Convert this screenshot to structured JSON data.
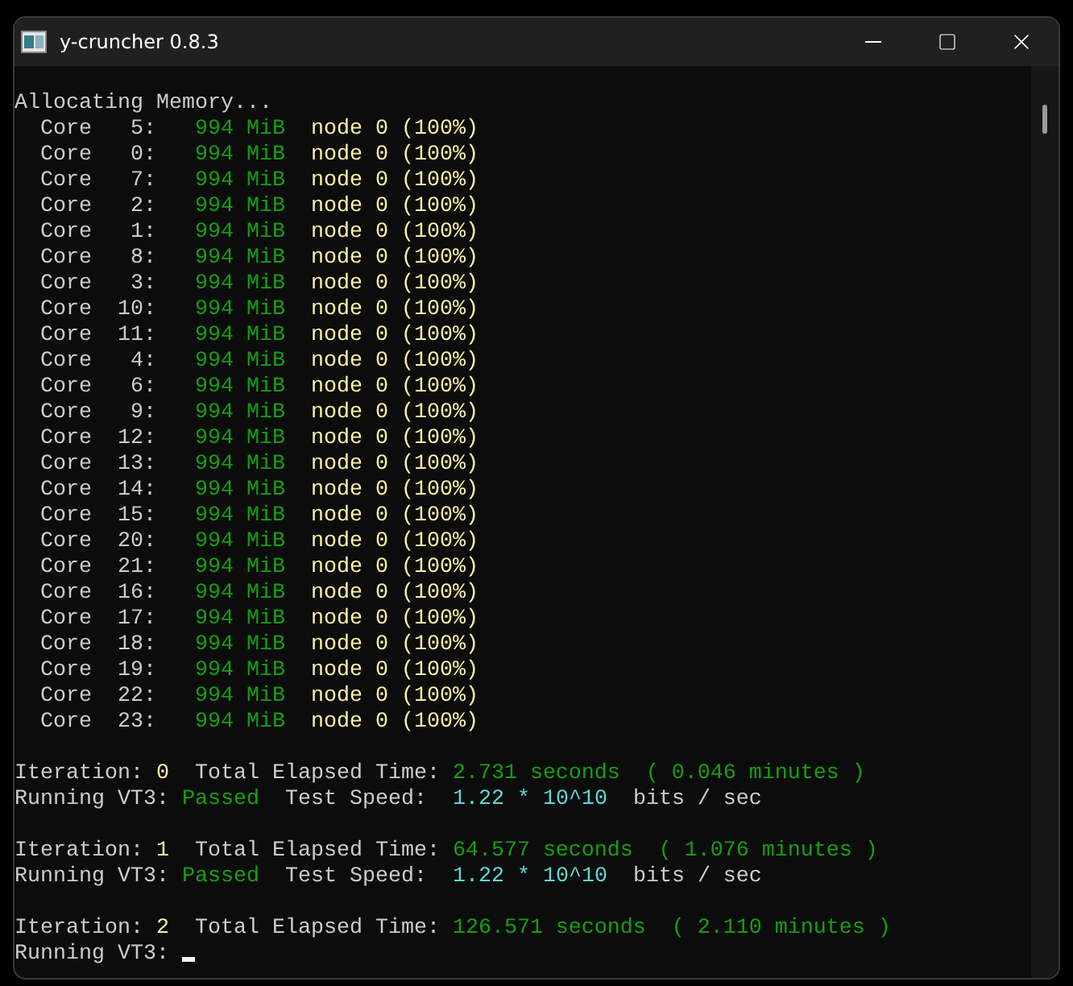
{
  "window": {
    "title": "y-cruncher 0.8.3"
  },
  "lines": [
    {
      "kind": "blank"
    },
    {
      "kind": "text",
      "segments": [
        {
          "text": "Allocating Memory...",
          "color": "#cccccc"
        }
      ]
    },
    {
      "kind": "text",
      "segments": [
        {
          "text": "  Core   5:",
          "color": "#cccccc"
        },
        {
          "text": "   994 MiB",
          "color": "#13a10e"
        },
        {
          "text": "  node 0 (100%)",
          "color": "#f9f1a5"
        }
      ]
    },
    {
      "kind": "text",
      "segments": [
        {
          "text": "  Core   0:",
          "color": "#cccccc"
        },
        {
          "text": "   994 MiB",
          "color": "#13a10e"
        },
        {
          "text": "  node 0 (100%)",
          "color": "#f9f1a5"
        }
      ]
    },
    {
      "kind": "text",
      "segments": [
        {
          "text": "  Core   7:",
          "color": "#cccccc"
        },
        {
          "text": "   994 MiB",
          "color": "#13a10e"
        },
        {
          "text": "  node 0 (100%)",
          "color": "#f9f1a5"
        }
      ]
    },
    {
      "kind": "text",
      "segments": [
        {
          "text": "  Core   2:",
          "color": "#cccccc"
        },
        {
          "text": "   994 MiB",
          "color": "#13a10e"
        },
        {
          "text": "  node 0 (100%)",
          "color": "#f9f1a5"
        }
      ]
    },
    {
      "kind": "text",
      "segments": [
        {
          "text": "  Core   1:",
          "color": "#cccccc"
        },
        {
          "text": "   994 MiB",
          "color": "#13a10e"
        },
        {
          "text": "  node 0 (100%)",
          "color": "#f9f1a5"
        }
      ]
    },
    {
      "kind": "text",
      "segments": [
        {
          "text": "  Core   8:",
          "color": "#cccccc"
        },
        {
          "text": "   994 MiB",
          "color": "#13a10e"
        },
        {
          "text": "  node 0 (100%)",
          "color": "#f9f1a5"
        }
      ]
    },
    {
      "kind": "text",
      "segments": [
        {
          "text": "  Core   3:",
          "color": "#cccccc"
        },
        {
          "text": "   994 MiB",
          "color": "#13a10e"
        },
        {
          "text": "  node 0 (100%)",
          "color": "#f9f1a5"
        }
      ]
    },
    {
      "kind": "text",
      "segments": [
        {
          "text": "  Core  10:",
          "color": "#cccccc"
        },
        {
          "text": "   994 MiB",
          "color": "#13a10e"
        },
        {
          "text": "  node 0 (100%)",
          "color": "#f9f1a5"
        }
      ]
    },
    {
      "kind": "text",
      "segments": [
        {
          "text": "  Core  11:",
          "color": "#cccccc"
        },
        {
          "text": "   994 MiB",
          "color": "#13a10e"
        },
        {
          "text": "  node 0 (100%)",
          "color": "#f9f1a5"
        }
      ]
    },
    {
      "kind": "text",
      "segments": [
        {
          "text": "  Core   4:",
          "color": "#cccccc"
        },
        {
          "text": "   994 MiB",
          "color": "#13a10e"
        },
        {
          "text": "  node 0 (100%)",
          "color": "#f9f1a5"
        }
      ]
    },
    {
      "kind": "text",
      "segments": [
        {
          "text": "  Core   6:",
          "color": "#cccccc"
        },
        {
          "text": "   994 MiB",
          "color": "#13a10e"
        },
        {
          "text": "  node 0 (100%)",
          "color": "#f9f1a5"
        }
      ]
    },
    {
      "kind": "text",
      "segments": [
        {
          "text": "  Core   9:",
          "color": "#cccccc"
        },
        {
          "text": "   994 MiB",
          "color": "#13a10e"
        },
        {
          "text": "  node 0 (100%)",
          "color": "#f9f1a5"
        }
      ]
    },
    {
      "kind": "text",
      "segments": [
        {
          "text": "  Core  12:",
          "color": "#cccccc"
        },
        {
          "text": "   994 MiB",
          "color": "#13a10e"
        },
        {
          "text": "  node 0 (100%)",
          "color": "#f9f1a5"
        }
      ]
    },
    {
      "kind": "text",
      "segments": [
        {
          "text": "  Core  13:",
          "color": "#cccccc"
        },
        {
          "text": "   994 MiB",
          "color": "#13a10e"
        },
        {
          "text": "  node 0 (100%)",
          "color": "#f9f1a5"
        }
      ]
    },
    {
      "kind": "text",
      "segments": [
        {
          "text": "  Core  14:",
          "color": "#cccccc"
        },
        {
          "text": "   994 MiB",
          "color": "#13a10e"
        },
        {
          "text": "  node 0 (100%)",
          "color": "#f9f1a5"
        }
      ]
    },
    {
      "kind": "text",
      "segments": [
        {
          "text": "  Core  15:",
          "color": "#cccccc"
        },
        {
          "text": "   994 MiB",
          "color": "#13a10e"
        },
        {
          "text": "  node 0 (100%)",
          "color": "#f9f1a5"
        }
      ]
    },
    {
      "kind": "text",
      "segments": [
        {
          "text": "  Core  20:",
          "color": "#cccccc"
        },
        {
          "text": "   994 MiB",
          "color": "#13a10e"
        },
        {
          "text": "  node 0 (100%)",
          "color": "#f9f1a5"
        }
      ]
    },
    {
      "kind": "text",
      "segments": [
        {
          "text": "  Core  21:",
          "color": "#cccccc"
        },
        {
          "text": "   994 MiB",
          "color": "#13a10e"
        },
        {
          "text": "  node 0 (100%)",
          "color": "#f9f1a5"
        }
      ]
    },
    {
      "kind": "text",
      "segments": [
        {
          "text": "  Core  16:",
          "color": "#cccccc"
        },
        {
          "text": "   994 MiB",
          "color": "#13a10e"
        },
        {
          "text": "  node 0 (100%)",
          "color": "#f9f1a5"
        }
      ]
    },
    {
      "kind": "text",
      "segments": [
        {
          "text": "  Core  17:",
          "color": "#cccccc"
        },
        {
          "text": "   994 MiB",
          "color": "#13a10e"
        },
        {
          "text": "  node 0 (100%)",
          "color": "#f9f1a5"
        }
      ]
    },
    {
      "kind": "text",
      "segments": [
        {
          "text": "  Core  18:",
          "color": "#cccccc"
        },
        {
          "text": "   994 MiB",
          "color": "#13a10e"
        },
        {
          "text": "  node 0 (100%)",
          "color": "#f9f1a5"
        }
      ]
    },
    {
      "kind": "text",
      "segments": [
        {
          "text": "  Core  19:",
          "color": "#cccccc"
        },
        {
          "text": "   994 MiB",
          "color": "#13a10e"
        },
        {
          "text": "  node 0 (100%)",
          "color": "#f9f1a5"
        }
      ]
    },
    {
      "kind": "text",
      "segments": [
        {
          "text": "  Core  22:",
          "color": "#cccccc"
        },
        {
          "text": "   994 MiB",
          "color": "#13a10e"
        },
        {
          "text": "  node 0 (100%)",
          "color": "#f9f1a5"
        }
      ]
    },
    {
      "kind": "text",
      "segments": [
        {
          "text": "  Core  23:",
          "color": "#cccccc"
        },
        {
          "text": "   994 MiB",
          "color": "#13a10e"
        },
        {
          "text": "  node 0 (100%)",
          "color": "#f9f1a5"
        }
      ]
    },
    {
      "kind": "blank"
    },
    {
      "kind": "text",
      "segments": [
        {
          "text": "Iteration:",
          "color": "#cccccc"
        },
        {
          "text": " 0",
          "color": "#f9f1a5"
        },
        {
          "text": "  Total Elapsed Time:",
          "color": "#cccccc"
        },
        {
          "text": " 2.731 seconds  ( 0.046 minutes )",
          "color": "#13a10e"
        }
      ]
    },
    {
      "kind": "text",
      "segments": [
        {
          "text": "Running VT3:",
          "color": "#cccccc"
        },
        {
          "text": " Passed",
          "color": "#13a10e"
        },
        {
          "text": "  Test Speed:",
          "color": "#cccccc"
        },
        {
          "text": "  1.22 * 10^10",
          "color": "#61d6d6"
        },
        {
          "text": "  bits / sec",
          "color": "#cccccc"
        }
      ]
    },
    {
      "kind": "blank"
    },
    {
      "kind": "text",
      "segments": [
        {
          "text": "Iteration:",
          "color": "#cccccc"
        },
        {
          "text": " 1",
          "color": "#f9f1a5"
        },
        {
          "text": "  Total Elapsed Time:",
          "color": "#cccccc"
        },
        {
          "text": " 64.577 seconds  ( 1.076 minutes )",
          "color": "#13a10e"
        }
      ]
    },
    {
      "kind": "text",
      "segments": [
        {
          "text": "Running VT3:",
          "color": "#cccccc"
        },
        {
          "text": " Passed",
          "color": "#13a10e"
        },
        {
          "text": "  Test Speed:",
          "color": "#cccccc"
        },
        {
          "text": "  1.22 * 10^10",
          "color": "#61d6d6"
        },
        {
          "text": "  bits / sec",
          "color": "#cccccc"
        }
      ]
    },
    {
      "kind": "blank"
    },
    {
      "kind": "text",
      "segments": [
        {
          "text": "Iteration:",
          "color": "#cccccc"
        },
        {
          "text": " 2",
          "color": "#f9f1a5"
        },
        {
          "text": "  Total Elapsed Time:",
          "color": "#cccccc"
        },
        {
          "text": " 126.571 seconds  ( 2.110 minutes )",
          "color": "#13a10e"
        }
      ]
    },
    {
      "kind": "prompt",
      "segments": [
        {
          "text": "Running VT3:",
          "color": "#cccccc"
        }
      ]
    }
  ]
}
